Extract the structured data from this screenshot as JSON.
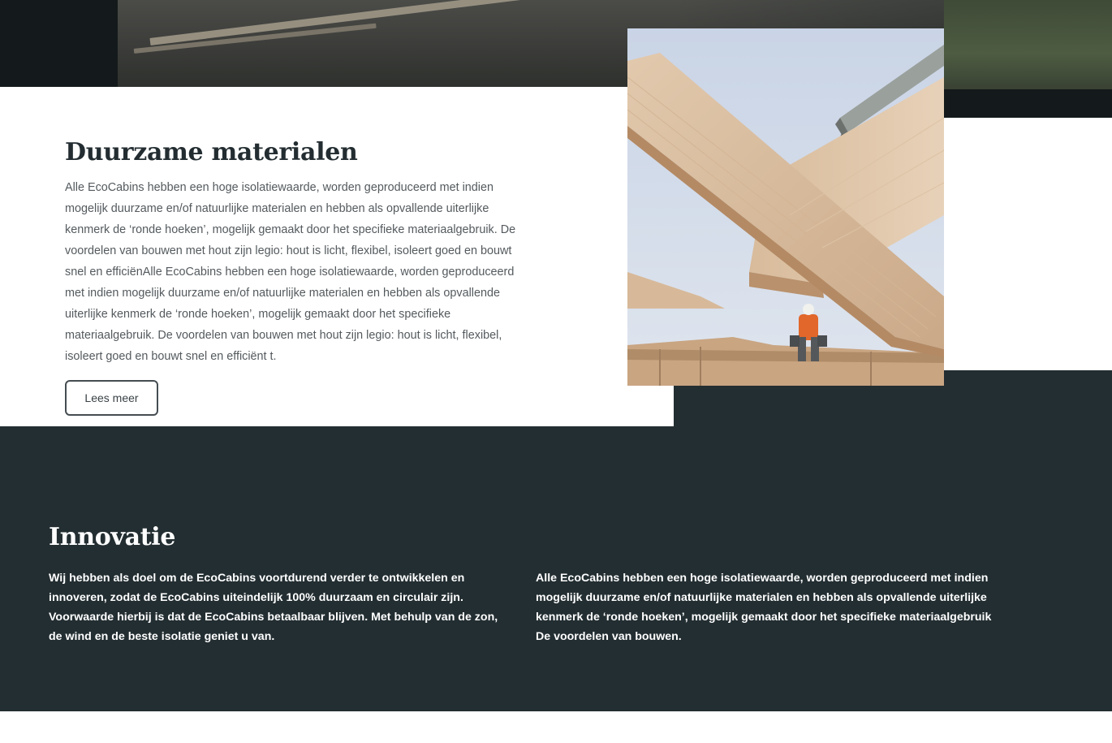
{
  "materials": {
    "title": "Duurzame materialen",
    "body": "Alle EcoCabins hebben een hoge isolatiewaarde, worden geproduceerd met indien mogelijk duurzame en/of natuurlijke materialen en hebben als opvallende uiterlijke kenmerk de ‘ronde hoeken’, mogelijk gemaakt door het specifieke materiaalgebruik. De voordelen van bouwen met hout zijn legio: hout is licht, flexibel, isoleert goed en bouwt snel en efficiënAlle EcoCabins hebben een hoge isolatiewaarde, worden geproduceerd met indien mogelijk duurzame en/of natuurlijke materialen en hebben als opvallende uiterlijke kenmerk de ‘ronde hoeken’, mogelijk gemaakt door het specifieke materiaalgebruik. De voordelen van bouwen met hout zijn legio: hout is licht, flexibel, isoleert goed en bouwt snel en efficiënt t.",
    "button_label": "Lees meer"
  },
  "innovation": {
    "title": "Innovatie",
    "col1": "Wij hebben als doel om de EcoCabins voortdurend verder te ontwikkelen en innoveren, zodat de EcoCabins uiteindelijk 100% duurzaam en circulair zijn. Voorwaarde hierbij is dat de EcoCabins betaalbaar blijven. Met behulp van de zon, de wind en de beste isolatie geniet u van.",
    "col2": "Alle EcoCabins hebben een hoge isolatiewaarde, worden geproduceerd met indien mogelijk duurzame en/of natuurlijke materialen en hebben als opvallende uiterlijke kenmerk de ‘ronde hoeken’, mogelijk gemaakt door het specifieke materiaalgebruik De voordelen van bouwen."
  },
  "colors": {
    "dark_section": "#232e32",
    "top_band": "#141a1b",
    "heading": "#232d31",
    "body_text": "#545a5e"
  }
}
